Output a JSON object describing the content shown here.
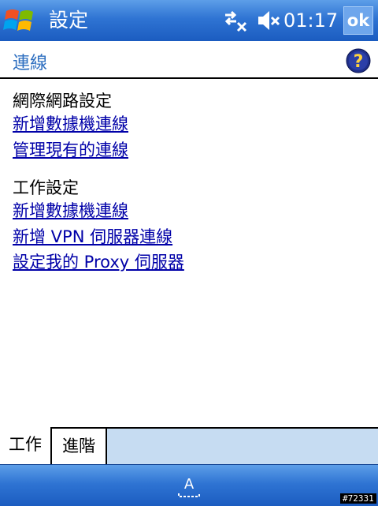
{
  "titlebar": {
    "app_title": "設定",
    "clock": "01:17",
    "ok_label": "ok"
  },
  "page": {
    "title": "連線"
  },
  "sections": [
    {
      "heading": "網際網路設定",
      "links": [
        "新增數據機連線",
        "管理現有的連線"
      ]
    },
    {
      "heading": "工作設定",
      "links": [
        "新增數據機連線",
        "新增 VPN 伺服器連線",
        "設定我的 Proxy 伺服器"
      ]
    }
  ],
  "tabs": [
    {
      "label": "工作",
      "active": true
    },
    {
      "label": "進階",
      "active": false
    }
  ],
  "icons": {
    "start": "windows-flag-icon",
    "connectivity": "connectivity-off-icon",
    "volume": "volume-off-icon",
    "help": "help-icon",
    "sip": "input-panel-icon"
  },
  "watermark": "#72331",
  "colors": {
    "bar_blue": "#2f74d3",
    "title_text": "#2e6fc0",
    "link": "#0000a8",
    "tab_strip": "#c6dcf2"
  }
}
